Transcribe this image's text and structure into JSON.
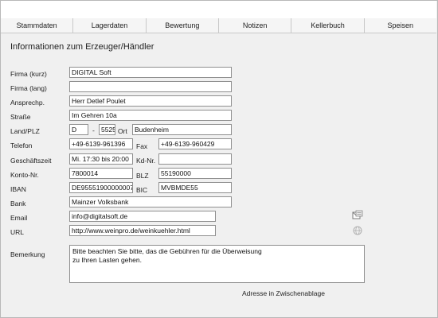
{
  "tabs": [
    {
      "label": "Stammdaten"
    },
    {
      "label": "Lagerdaten"
    },
    {
      "label": "Bewertung"
    },
    {
      "label": "Notizen"
    },
    {
      "label": "Kellerbuch"
    },
    {
      "label": "Speisen"
    }
  ],
  "section_title": "Informationen zum Erzeuger/Händler",
  "labels": {
    "firma_kurz": "Firma (kurz)",
    "firma_lang": "Firma (lang)",
    "ansprech": "Ansprechp.",
    "strasse": "Straße",
    "land_plz": "Land/PLZ",
    "plz_sep": "-",
    "ort": "Ort",
    "telefon": "Telefon",
    "fax": "Fax",
    "geschaeftszeit": "Geschäftszeit",
    "kdnr": "Kd-Nr.",
    "konto": "Konto-Nr.",
    "blz": "BLZ",
    "iban": "IBAN",
    "bic": "BIC",
    "bank": "Bank",
    "email": "Email",
    "url": "URL",
    "bemerkung": "Bemerkung"
  },
  "fields": {
    "firma_kurz": "DIGITAL Soft",
    "firma_lang": "",
    "ansprech": "Herr Detlef Poulet",
    "strasse": "Im Gehren 10a",
    "land": "D",
    "plz": "5525",
    "ort": "Budenheim",
    "telefon": "+49-6139-961396",
    "fax": "+49-6139-960429",
    "geschaeftszeit": "Mi. 17:30 bis 20:00",
    "kdnr": "",
    "konto": "7800014",
    "blz": "55190000",
    "iban": "DE95551900000007",
    "bic": "MVBMDE55",
    "bank": "Mainzer Volksbank",
    "email": "info@digitalsoft.de",
    "url": "http://www.weinpro.de/weinkuehler.html",
    "bemerkung": "Bitte beachten Sie bitte, das die Gebühren für die Überweisung\nzu Ihren Lasten gehen."
  },
  "actions": {
    "clipboard_label": "Adresse in Zwischenablage"
  },
  "icons": {
    "email_icon": "mail-icon",
    "url_icon": "globe-icon"
  },
  "colors": {
    "background": "#f0f0f0",
    "field_border": "#8f8f8f",
    "field_bg": "#ffffff"
  }
}
